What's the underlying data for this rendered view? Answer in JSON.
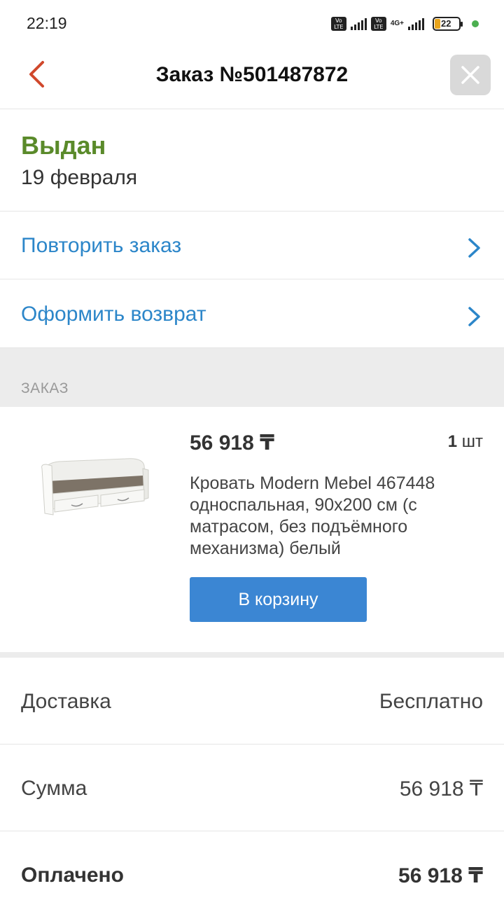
{
  "status_bar": {
    "time": "22:19",
    "volte_label": "Vo LTE",
    "network_label": "4G+",
    "battery_level": "22",
    "icons": [
      "volte-icon",
      "signal-icon",
      "volte-icon",
      "4g-signal-icon",
      "battery-icon",
      "notification-dot-icon"
    ]
  },
  "header": {
    "title": "Заказ №501487872",
    "back_icon": "chevron-left-icon",
    "close_icon": "close-icon"
  },
  "order_status": {
    "status": "Выдан",
    "date": "19 февраля"
  },
  "actions": [
    {
      "label": "Повторить заказ"
    },
    {
      "label": "Оформить возврат"
    }
  ],
  "section_title": "ЗАКАЗ",
  "item": {
    "price": "56 918 ₸",
    "qty_number": "1",
    "qty_unit": "шт",
    "name": "Кровать Modern Mebel 467448 односпальная, 90x200 см (с матрасом, без подъёмного механизма) белый",
    "cart_button": "В корзину"
  },
  "summary": [
    {
      "key": "Доставка",
      "value": "Бесплатно"
    },
    {
      "key": "Сумма",
      "value": "56 918 ₸"
    },
    {
      "key": "Оплачено",
      "value": "56 918 ₸"
    }
  ],
  "colors": {
    "status_green": "#5a8a2a",
    "link_blue": "#2c86c9",
    "button_blue": "#3b86d3",
    "back_red": "#d0482c"
  }
}
